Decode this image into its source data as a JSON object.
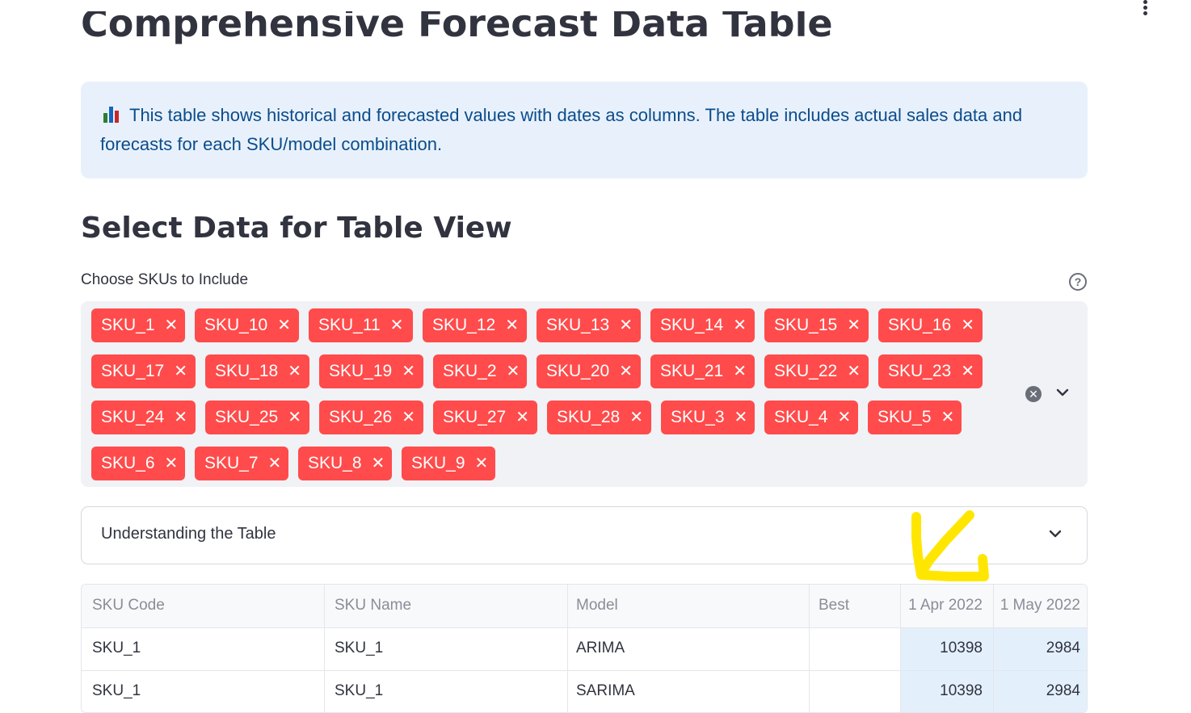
{
  "page": {
    "title": "Comprehensive Forecast Data Table",
    "info_text": "This table shows historical and forecasted values with dates as columns. The table includes actual sales data and forecasts for each SKU/model combination.",
    "section_title": "Select Data for Table View"
  },
  "sku_select": {
    "label": "Choose SKUs to Include",
    "help_icon": "question-circle-icon",
    "remove_icon": "close-icon",
    "clear_icon": "clear-all-icon",
    "dropdown_icon": "chevron-down-icon",
    "tags": [
      "SKU_1",
      "SKU_10",
      "SKU_11",
      "SKU_12",
      "SKU_13",
      "SKU_14",
      "SKU_15",
      "SKU_16",
      "SKU_17",
      "SKU_18",
      "SKU_19",
      "SKU_2",
      "SKU_20",
      "SKU_21",
      "SKU_22",
      "SKU_23",
      "SKU_24",
      "SKU_25",
      "SKU_26",
      "SKU_27",
      "SKU_28",
      "SKU_3",
      "SKU_4",
      "SKU_5",
      "SKU_6",
      "SKU_7",
      "SKU_8",
      "SKU_9"
    ]
  },
  "expander": {
    "label": "Understanding the Table",
    "icon": "chevron-down-icon"
  },
  "table": {
    "columns": [
      "SKU Code",
      "SKU Name",
      "Model",
      "Best",
      "1 Apr 2022",
      "1 May 2022"
    ],
    "rows": [
      [
        "SKU_1",
        "SKU_1",
        "ARIMA",
        "",
        "10398",
        "2984"
      ],
      [
        "SKU_1",
        "SKU_1",
        "SARIMA",
        "",
        "10398",
        "2984"
      ]
    ]
  },
  "colors": {
    "tag": "#ff4b4b",
    "info_bg": "#e8f1fb",
    "info_text": "#0b4c8c",
    "annotation": "#ffe600",
    "cell_highlight": "#e3f0fc"
  }
}
